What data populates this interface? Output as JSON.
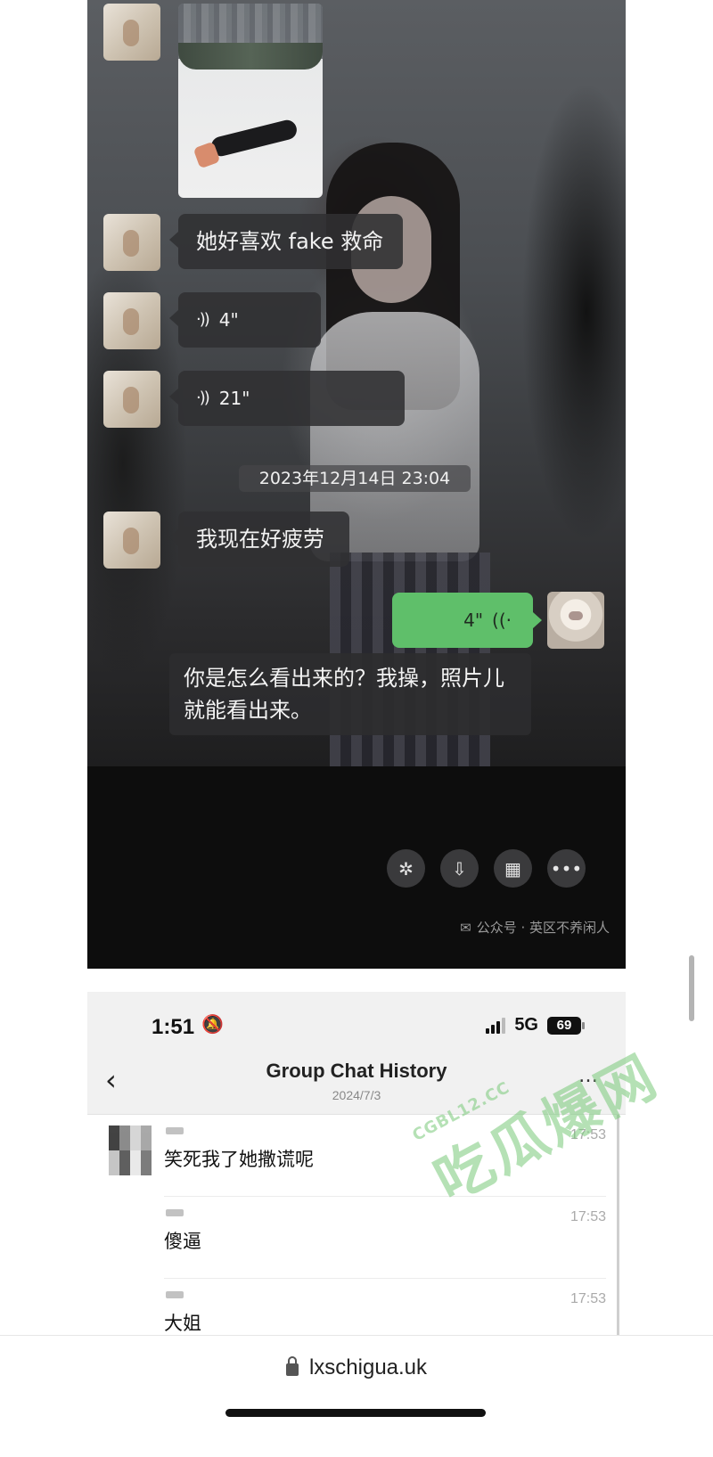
{
  "top_chat": {
    "messages": {
      "text1": "她好喜欢 fake 救命",
      "voice1_duration": "4\"",
      "voice2_duration": "21\"",
      "text2": "我现在好疲劳"
    },
    "timestamp": "2023年12月14日 23:04",
    "outgoing_voice_duration": "4\"",
    "caption": "你是怎么看出来的？我操，照片儿就能看出来。",
    "action_icons": [
      "sparkle-icon",
      "download-icon",
      "grid-icon",
      "more-icon"
    ],
    "attribution": "公众号 · 英区不养闲人"
  },
  "group_chat": {
    "status": {
      "time": "1:51",
      "network": "5G",
      "battery": "69"
    },
    "header": {
      "title": "Group Chat History",
      "date": "2024/7/3",
      "more": "…"
    },
    "messages": [
      {
        "text": "笑死我了她撒谎呢",
        "time": "17:53"
      },
      {
        "text": "傻逼",
        "time": "17:53"
      },
      {
        "text": "大姐",
        "time": "17:53"
      }
    ]
  },
  "watermark": {
    "main": "吃瓜爆网",
    "sub": "CGBL12.CC"
  },
  "browser": {
    "url": "lxschigua.uk"
  },
  "colors": {
    "outgoing_bubble": "#5fbf6a",
    "dark_bubble": "#303032"
  }
}
